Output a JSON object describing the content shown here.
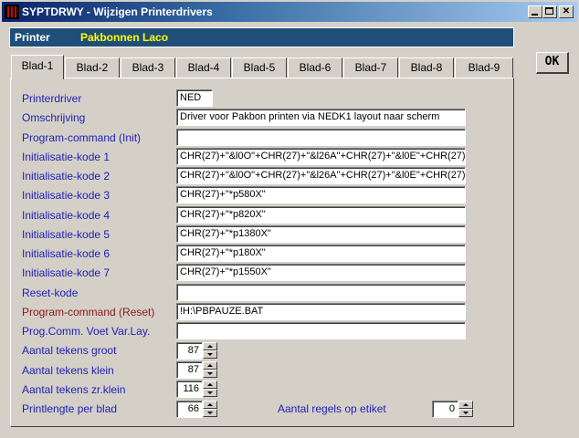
{
  "window": {
    "title": "SYPTDRWY - Wijzigen Printerdrivers"
  },
  "printer_bar": {
    "label": "Printer",
    "value": "Pakbonnen Laco"
  },
  "ok_label": "OK",
  "tabs": [
    "Blad-1",
    "Blad-2",
    "Blad-3",
    "Blad-4",
    "Blad-5",
    "Blad-6",
    "Blad-7",
    "Blad-8",
    "Blad-9"
  ],
  "fields": {
    "printerdriver": {
      "label": "Printerdriver",
      "value": "NED"
    },
    "omschrijving": {
      "label": "Omschrijving",
      "value": "Driver voor Pakbon printen via NEDK1 layout naar scherm"
    },
    "program_command_init": {
      "label": "Program-command (Init)",
      "value": ""
    },
    "init_1": {
      "label": "Initialisatie-kode 1",
      "value": "CHR(27)+\"&l0O\"+CHR(27)+\"&l26A\"+CHR(27)+\"&l0E\"+CHR(27)+\""
    },
    "init_2": {
      "label": "Initialisatie-kode 2",
      "value": "CHR(27)+\"&l0O\"+CHR(27)+\"&l26A\"+CHR(27)+\"&l0E\"+CHR(27)+\""
    },
    "init_3": {
      "label": "Initialisatie-kode 3",
      "value": "CHR(27)+\"*p580X\""
    },
    "init_4": {
      "label": "Initialisatie-kode 4",
      "value": "CHR(27)+\"*p820X\""
    },
    "init_5": {
      "label": "Initialisatie-kode 5",
      "value": "CHR(27)+\"*p1380X\""
    },
    "init_6": {
      "label": "Initialisatie-kode 6",
      "value": "CHR(27)+\"*p180X\""
    },
    "init_7": {
      "label": "Initialisatie-kode 7",
      "value": "CHR(27)+\"*p1550X\""
    },
    "reset_kode": {
      "label": "Reset-kode",
      "value": ""
    },
    "program_command_reset": {
      "label": "Program-command (Reset)",
      "value": "!H:\\PBPAUZE.BAT"
    },
    "prog_comm_voet": {
      "label": "Prog.Comm. Voet Var.Lay.",
      "value": ""
    },
    "tekens_groot": {
      "label": "Aantal tekens groot",
      "value": "87"
    },
    "tekens_klein": {
      "label": "Aantal tekens klein",
      "value": "87"
    },
    "tekens_zr_klein": {
      "label": "Aantal tekens zr.klein",
      "value": "116"
    },
    "printlengte": {
      "label": "Printlengte per blad",
      "value": "66"
    },
    "regels_etiket": {
      "label": "Aantal regels op etiket",
      "value": "0"
    }
  }
}
